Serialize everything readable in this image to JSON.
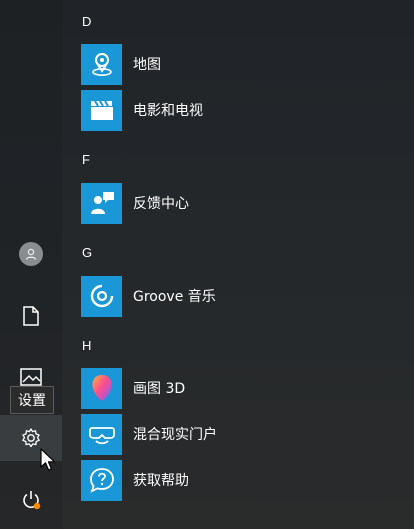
{
  "start_menu": {
    "rail": {
      "tooltip": "设置",
      "items": [
        {
          "icon": "user-avatar-icon"
        },
        {
          "icon": "document-icon"
        },
        {
          "icon": "pictures-icon"
        },
        {
          "icon": "gear-icon"
        },
        {
          "icon": "power-icon"
        }
      ]
    },
    "apps": {
      "groups": [
        {
          "letter": "D",
          "items": [
            {
              "label": "地图",
              "icon": "map-pin-icon"
            },
            {
              "label": "电影和电视",
              "icon": "clapperboard-icon"
            }
          ]
        },
        {
          "letter": "F",
          "items": [
            {
              "label": "反馈中心",
              "icon": "feedback-person-icon"
            }
          ]
        },
        {
          "letter": "G",
          "items": [
            {
              "label": "Groove 音乐",
              "icon": "groove-disc-icon"
            }
          ]
        },
        {
          "letter": "H",
          "items": [
            {
              "label": "画图 3D",
              "icon": "paint3d-icon"
            },
            {
              "label": "混合现实门户",
              "icon": "mr-headset-icon"
            },
            {
              "label": "获取帮助",
              "icon": "help-question-icon"
            }
          ]
        }
      ]
    }
  },
  "colors": {
    "tile": "#1a97d6",
    "background": "#24282b",
    "notification_dot": "#ff8c00"
  }
}
